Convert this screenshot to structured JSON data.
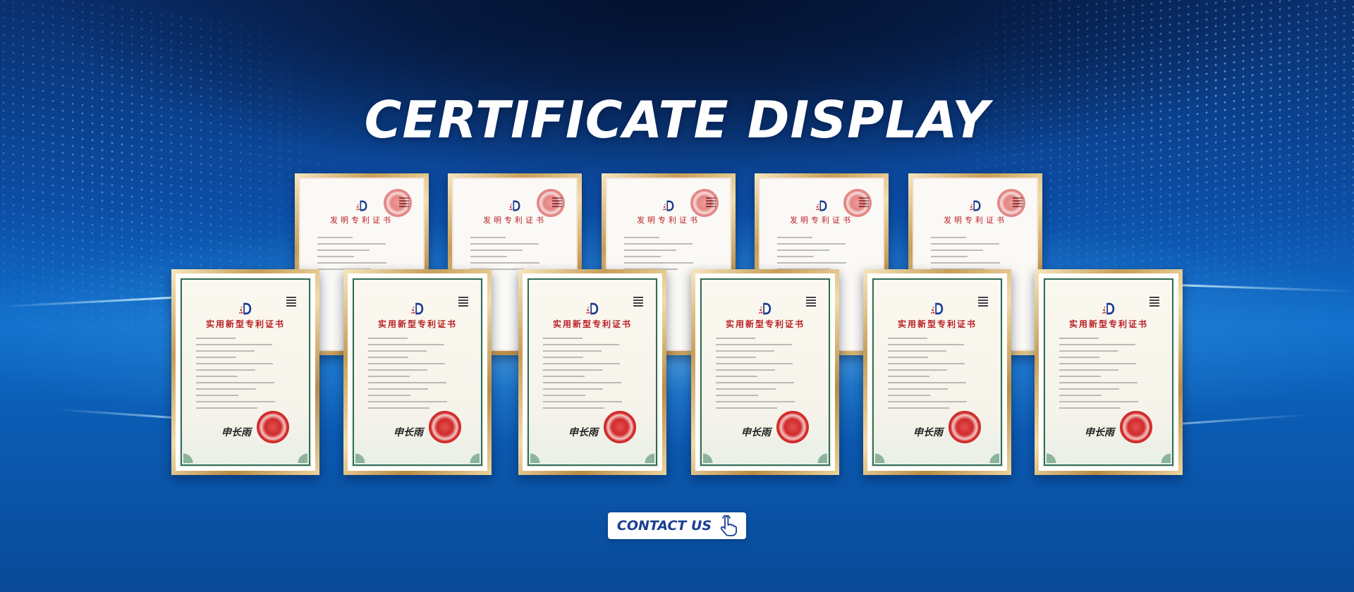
{
  "banner": {
    "title": "CERTIFICATE DISPLAY",
    "contact_label": "CONTACT US"
  },
  "icons": {
    "contact": "pointing-hand-icon",
    "logo": "cnipa-logo",
    "seal": "red-official-seal"
  },
  "certificates": {
    "back_row": [
      {
        "title": "发明专利证书"
      },
      {
        "title": "发明专利证书"
      },
      {
        "title": "发明专利证书"
      },
      {
        "title": "发明专利证书"
      },
      {
        "title": "发明专利证书"
      }
    ],
    "front_row": [
      {
        "title": "实用新型专利证书",
        "signature": "申长雨"
      },
      {
        "title": "实用新型专利证书",
        "signature": "申长雨"
      },
      {
        "title": "实用新型专利证书",
        "signature": "申长雨"
      },
      {
        "title": "实用新型专利证书",
        "signature": "申长雨"
      },
      {
        "title": "实用新型专利证书",
        "signature": "申长雨"
      },
      {
        "title": "实用新型专利证书",
        "signature": "申长雨"
      }
    ]
  },
  "colors": {
    "background": "#0c4ea6",
    "title_text": "#ffffff",
    "button_text": "#1a3f93",
    "certificate_red": "#b72025",
    "frame_gold": "#c79e57"
  }
}
